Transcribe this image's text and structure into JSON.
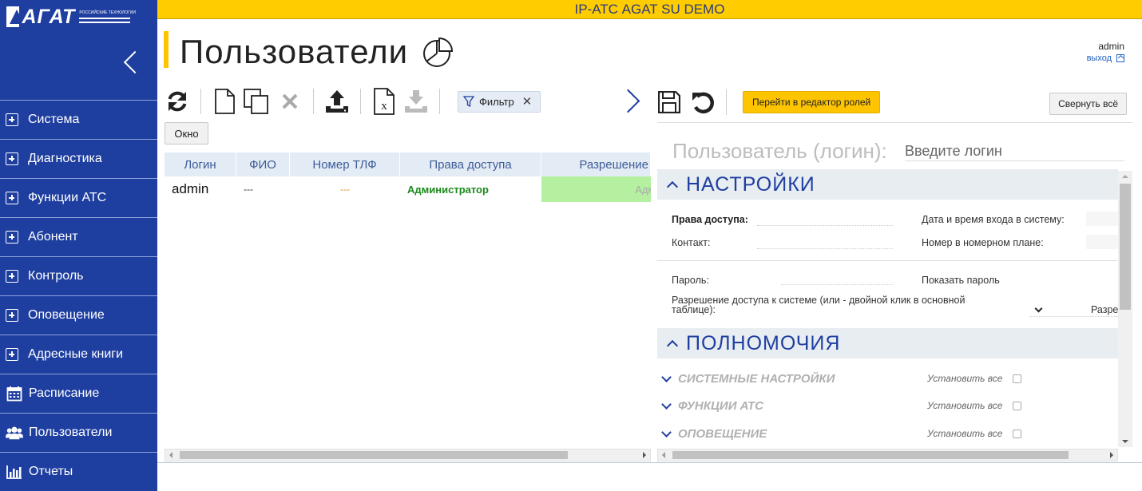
{
  "app": {
    "title": "IP-АТС AGAT SU DEMO",
    "logo_text": "АГАТ",
    "logo_sub": "РОССИЙСКИЕ ТЕХНОЛОГИИ"
  },
  "sidebar": {
    "items": [
      {
        "label": "Система",
        "icon": "plus-square-icon"
      },
      {
        "label": "Диагностика",
        "icon": "plus-square-icon"
      },
      {
        "label": "Функции АТС",
        "icon": "plus-square-icon"
      },
      {
        "label": "Абонент",
        "icon": "plus-square-icon"
      },
      {
        "label": "Контроль",
        "icon": "plus-square-icon"
      },
      {
        "label": "Оповещение",
        "icon": "plus-square-icon"
      },
      {
        "label": "Адресные книги",
        "icon": "plus-square-icon"
      },
      {
        "label": "Расписание",
        "icon": "calendar-icon"
      },
      {
        "label": "Пользователи",
        "icon": "users-icon"
      },
      {
        "label": "Отчеты",
        "icon": "bar-chart-icon"
      }
    ]
  },
  "header": {
    "page_title": "Пользователи",
    "user": "admin",
    "logout": "выход"
  },
  "toolbar": {
    "filter_label": "Фильтр"
  },
  "window_button": "Окно",
  "table": {
    "columns": [
      "Логин",
      "ФИО",
      "Номер ТЛФ",
      "Права доступа",
      "Разрешение"
    ],
    "rows": [
      {
        "login": "admin",
        "fio": "---",
        "tel": "---",
        "rights": "Администратор",
        "permission": "Администратор"
      }
    ]
  },
  "editor": {
    "roles_button": "Перейти в редактор ролей",
    "collapse_all": "Свернуть всё",
    "login_label": "Пользователь (логин):",
    "login_placeholder": "Введите логин",
    "settings_section": "НАСТРОЙКИ",
    "fields": {
      "access_rights": "Права доступа:",
      "contact": "Контакт:",
      "login_datetime": "Дата и время входа в систему:",
      "number_plan": "Номер в номерном плане:",
      "password": "Пароль:",
      "show_password": "Показать пароль",
      "system_access": "Разрешение доступа к системе (или - двойной клик в основной таблице):",
      "system_access_value": "Разрешено"
    },
    "permissions_section": "ПОЛНОМОЧИЯ",
    "permission_groups": [
      {
        "title": "СИСТЕМНЫЕ НАСТРОЙКИ",
        "set_all": "Установить все",
        "checked": false
      },
      {
        "title": "ФУНКЦИИ АТС",
        "set_all": "Установить все",
        "checked": false
      },
      {
        "title": "ОПОВЕЩЕНИЕ",
        "set_all": "Установить все",
        "checked": false
      }
    ]
  },
  "colors": {
    "sidebar_bg": "#1f3fa0",
    "topbar_bg": "#ffcc00",
    "accent": "#ffc400",
    "admin_green": "#1a8a1a",
    "permission_bg": "#b4f0a0"
  }
}
